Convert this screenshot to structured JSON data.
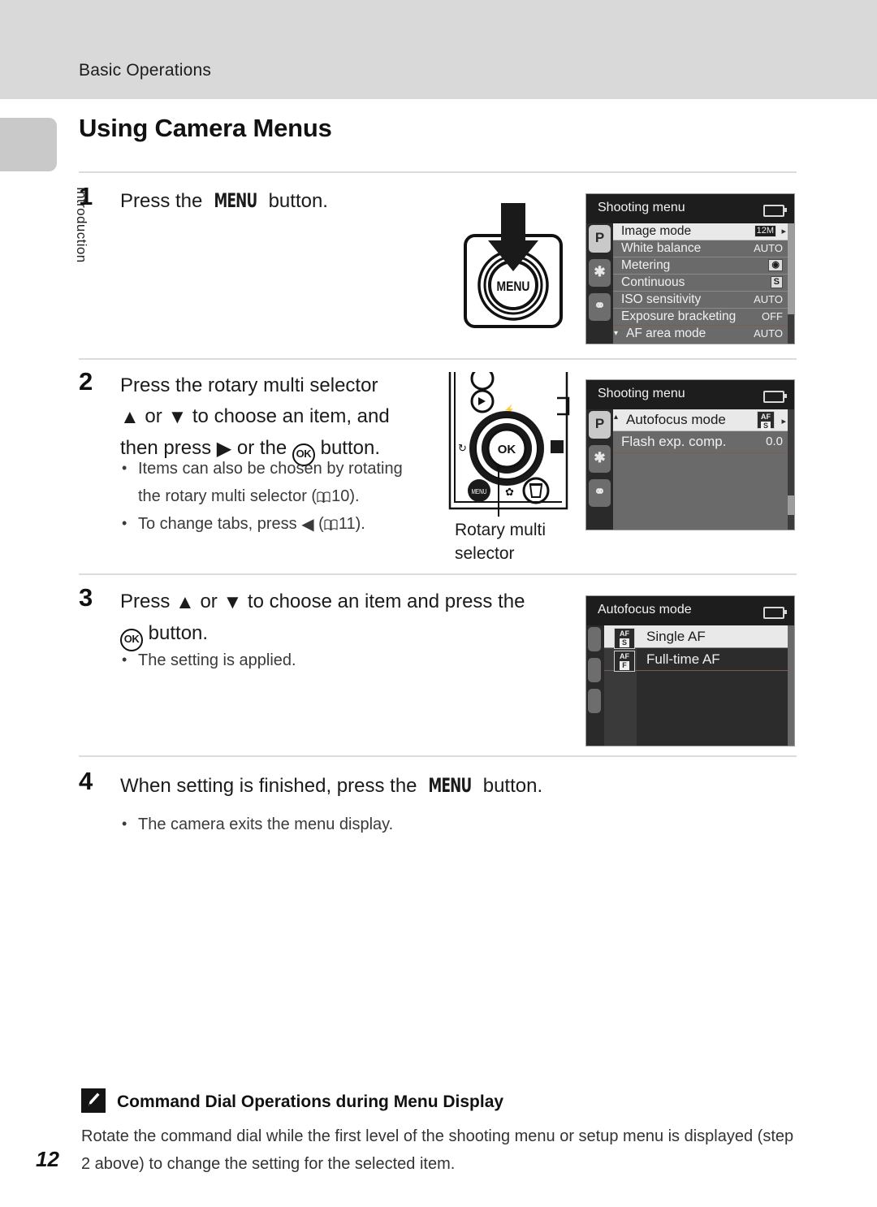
{
  "header": {
    "running_head": "Basic Operations",
    "chapter_tab": "Introduction"
  },
  "page": {
    "number": "12",
    "title": "Using Camera Menus"
  },
  "steps": [
    {
      "number": "1",
      "text_parts": {
        "pre": "Press the ",
        "glyph": "MENU",
        "post": " button."
      },
      "bullets": []
    },
    {
      "number": "2",
      "text_parts": {
        "l1_pre": "Press the rotary multi selector",
        "l2_pre": " or ",
        "l2_post": " to choose an item, and",
        "l3_pre": "then press ",
        "l3_mid": " or the ",
        "l3_ok": "OK",
        "l3_post": " button."
      },
      "bullets": [
        "Items can also be chosen by rotating the rotary multi selector (A10).",
        "To change tabs, press J (A11)."
      ],
      "bullet_1_a": "Items can also be chosen by rotating",
      "bullet_1_b": "the rotary multi selector (",
      "bullet_1_page": "10).",
      "bullet_2_a": "To change tabs, press ",
      "bullet_2_page": "11)."
    },
    {
      "number": "3",
      "text_parts": {
        "l1_pre": "Press ",
        "l1_mid": " or ",
        "l1_post": " to choose an item and press the",
        "l2_ok": "OK",
        "l2_post": " button."
      },
      "bullets": [
        "The setting is applied."
      ]
    },
    {
      "number": "4",
      "text_parts": {
        "pre": "When setting is finished, press the ",
        "glyph": "MENU",
        "post": " button."
      },
      "bullets": [
        "The camera exits the menu display."
      ]
    }
  ],
  "illustrations": {
    "menu_button_label": "MENU",
    "rotary_caption_line1": "Rotary multi",
    "rotary_caption_line2": "selector",
    "ok_button_label": "OK",
    "menu_small_label": "MENU"
  },
  "screenshots": [
    {
      "id": "shooting-menu-level1",
      "title": "Shooting menu",
      "tabs": [
        {
          "glyph": "P",
          "selected": true
        },
        {
          "glyph": "✱",
          "selected": false
        },
        {
          "glyph": "⚭",
          "selected": false
        }
      ],
      "rows": [
        {
          "label": "Image mode",
          "value": "12M",
          "value_type": "badge-dark",
          "selected": true,
          "arrow": true
        },
        {
          "label": "White balance",
          "value": "AUTO",
          "value_type": "text",
          "selected": false
        },
        {
          "label": "Metering",
          "value": "◉",
          "value_type": "badge-light",
          "selected": false
        },
        {
          "label": "Continuous",
          "value": "S",
          "value_type": "badge-light",
          "selected": false
        },
        {
          "label": "ISO sensitivity",
          "value": "AUTO",
          "value_type": "text",
          "selected": false
        },
        {
          "label": "Exposure bracketing",
          "value": "OFF",
          "value_type": "text",
          "selected": false
        },
        {
          "label": "AF area mode",
          "value": "AUTO",
          "value_type": "text",
          "selected": false,
          "caret": "down"
        }
      ]
    },
    {
      "id": "shooting-menu-level1-scrolled",
      "title": "Shooting menu",
      "tabs": [
        {
          "glyph": "P",
          "selected": true
        },
        {
          "glyph": "✱",
          "selected": false
        },
        {
          "glyph": "⚭",
          "selected": false
        }
      ],
      "rows": [
        {
          "label": "Autofocus mode",
          "value": "AF-S",
          "value_type": "af",
          "selected": true,
          "arrow": true,
          "caret": "up"
        },
        {
          "label": "Flash exp. comp.",
          "value": "0.0",
          "value_type": "text",
          "selected": false
        }
      ]
    },
    {
      "id": "autofocus-mode-menu",
      "title": "Autofocus mode",
      "options": [
        {
          "icon_top": "AF",
          "icon_bottom": "S",
          "label": "Single AF",
          "selected": true
        },
        {
          "icon_top": "AF",
          "icon_bottom": "F",
          "label": "Full-time AF",
          "selected": false
        }
      ]
    }
  ],
  "note": {
    "title": "Command Dial Operations during Menu Display",
    "body_line1": "Rotate the command dial while the first level of the shooting menu or setup menu is displayed (step",
    "body_line2": "2 above) to change the setting for the selected item."
  },
  "colors": {
    "header_bar": "#d9d9d9",
    "rule": "#dcdcdc",
    "screen_bg": "#6a6a6a",
    "screen_titlebar": "#1d1d1d",
    "selected_row": "#e9e9e9"
  }
}
